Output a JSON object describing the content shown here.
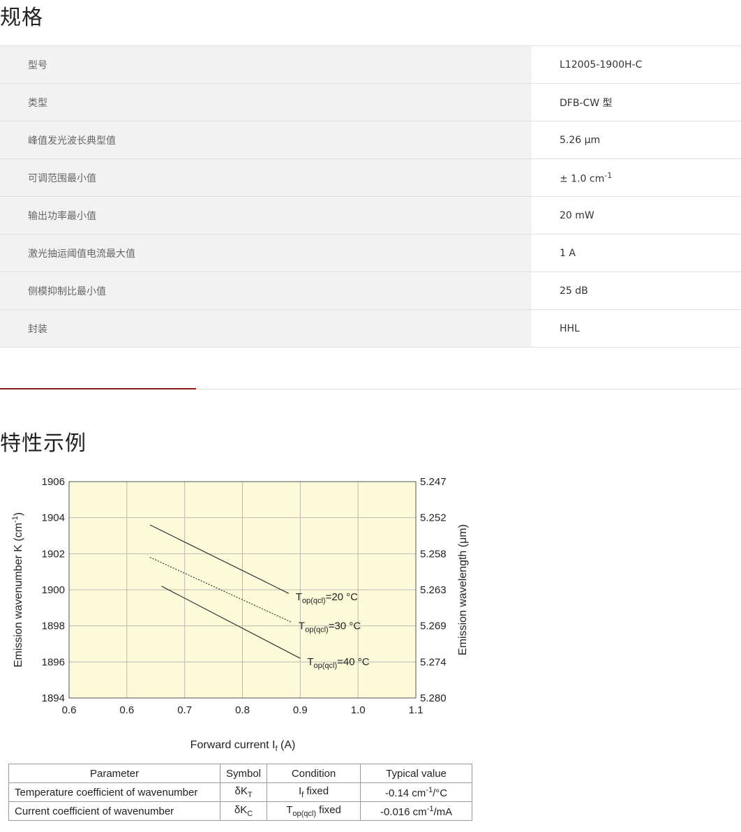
{
  "spec": {
    "title": "规格",
    "rows": [
      {
        "label": "型号",
        "value": "L12005-1900H-C"
      },
      {
        "label": "类型",
        "value": "DFB-CW 型"
      },
      {
        "label": "峰值发光波长典型值",
        "value": "5.26 μm"
      },
      {
        "label": "可调范围最小值",
        "value": "± 1.0 cm",
        "sup": "-1"
      },
      {
        "label": "输出功率最小值",
        "value": "20 mW"
      },
      {
        "label": "激光抽运阈值电流最大值",
        "value": "1 A"
      },
      {
        "label": "侧模抑制比最小值",
        "value": "25 dB"
      },
      {
        "label": "封装",
        "value": "HHL"
      }
    ]
  },
  "characteristics": {
    "title": "特性示例"
  },
  "chart_data": {
    "type": "line",
    "xlabel": "Forward current I",
    "xlabel_sub": "f",
    "xlabel_unit": " (A)",
    "ylabel": "Emission wavenumber K (cm",
    "ylabel_sup": "-1",
    "ylabel_end": ")",
    "y2label": "Emission wavelength (μm)",
    "x_ticks": [
      "0.6",
      "0.6",
      "0.7",
      "0.8",
      "0.9",
      "1.0",
      "1.1"
    ],
    "y_ticks": [
      "1894",
      "1896",
      "1898",
      "1900",
      "1902",
      "1904",
      "1906"
    ],
    "y2_ticks": [
      "5.280",
      "5.274",
      "5.269",
      "5.263",
      "5.258",
      "5.252",
      "5.247"
    ],
    "xlim": [
      0.5,
      1.1
    ],
    "ylim": [
      1894,
      1906
    ],
    "grid": true,
    "background": "#fdfad9",
    "series": [
      {
        "name": "T",
        "name_sub": "op(qcl)",
        "name_tail": "=20 °C",
        "style": "solid",
        "x": [
          0.64,
          0.88
        ],
        "y": [
          1903.6,
          1899.8
        ]
      },
      {
        "name": "T",
        "name_sub": "op(qcl)",
        "name_tail": "=30 °C",
        "style": "dotted",
        "x": [
          0.64,
          0.885
        ],
        "y": [
          1901.8,
          1898.2
        ]
      },
      {
        "name": "T",
        "name_sub": "op(qcl)",
        "name_tail": "=40 °C",
        "style": "solid",
        "x": [
          0.66,
          0.9
        ],
        "y": [
          1900.2,
          1896.2
        ]
      }
    ]
  },
  "param_table": {
    "headers": [
      "Parameter",
      "Symbol",
      "Condition",
      "Typical value"
    ],
    "rows": [
      {
        "parameter": "Temperature coefficient of wavenumber",
        "symbol": "δK",
        "symbol_sub": "T",
        "cond": "I",
        "cond_sub": "f",
        "cond_tail": " fixed",
        "value": "-0.14 cm",
        "value_sup": "-1",
        "value_tail": "/°C"
      },
      {
        "parameter": "Current coefficient of wavenumber",
        "symbol": "δK",
        "symbol_sub": "C",
        "cond": "T",
        "cond_sub": "op(qcl)",
        "cond_tail": " fixed",
        "value": "-0.016 cm",
        "value_sup": "-1",
        "value_tail": "/mA"
      }
    ]
  }
}
